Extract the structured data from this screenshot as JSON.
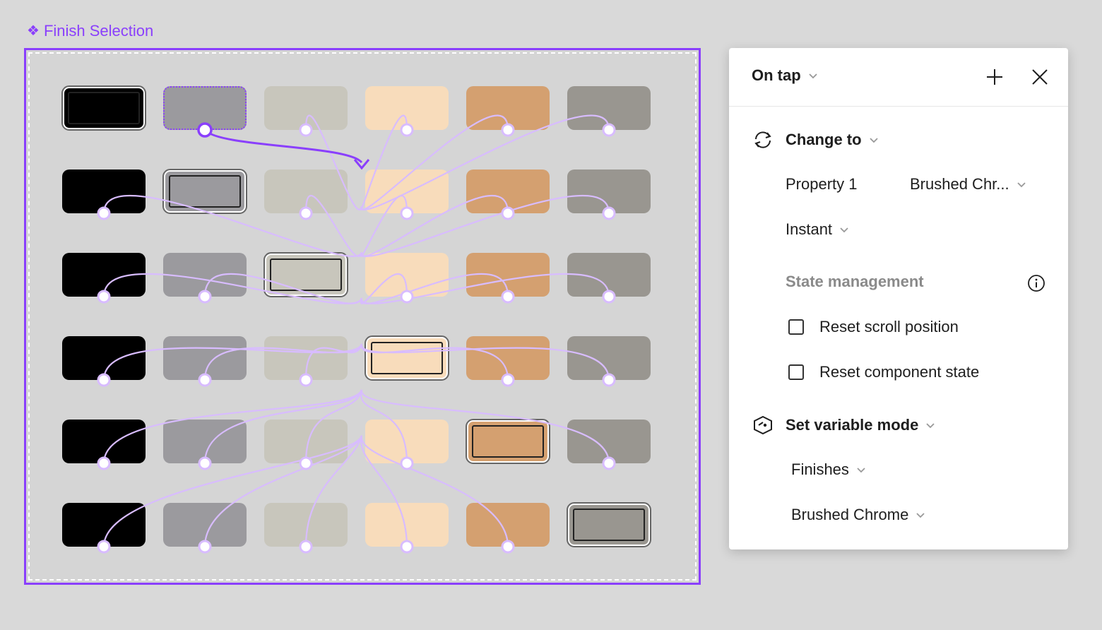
{
  "canvas": {
    "frame_label": "Finish Selection",
    "frame_label_icon": "component-icon",
    "accent_color": "#8a3ffc",
    "link_color": "#d8bcff",
    "swatch_colors": [
      "#000000",
      "#9b9a9e",
      "#c8c6bc",
      "#f8dcbb",
      "#d4a070",
      "#999690"
    ],
    "selected_swatch_per_row": [
      0,
      1,
      2,
      3,
      4,
      5
    ],
    "source_swatch": {
      "row": 0,
      "col": 1
    },
    "grid": {
      "rows": 6,
      "cols": 6
    }
  },
  "panel": {
    "trigger": "On tap",
    "add_icon": "plus-icon",
    "close_icon": "close-icon",
    "action": {
      "icon": "change-to-icon",
      "label": "Change to",
      "property_label": "Property 1",
      "property_value": "Brushed Chr...",
      "animation": "Instant"
    },
    "state_management": {
      "label": "State management",
      "info_icon": "info-icon",
      "options": [
        {
          "label": "Reset scroll position",
          "checked": false
        },
        {
          "label": "Reset component state",
          "checked": false
        }
      ]
    },
    "variable_mode": {
      "icon": "variable-mode-icon",
      "label": "Set variable mode",
      "collection": "Finishes",
      "mode": "Brushed Chrome"
    }
  }
}
